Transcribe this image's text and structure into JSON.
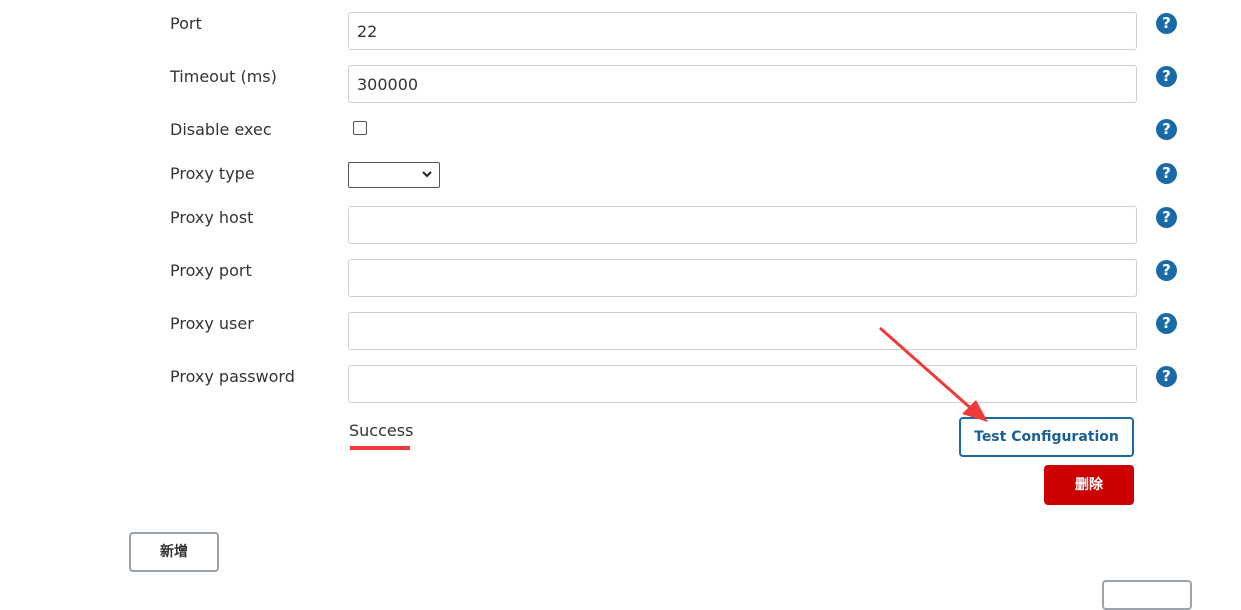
{
  "form": {
    "fields": [
      {
        "label": "Port",
        "value": "22",
        "help": "?"
      },
      {
        "label": "Timeout (ms)",
        "value": "300000",
        "help": "?"
      },
      {
        "label": "Disable exec",
        "checked": false,
        "help": "?"
      },
      {
        "label": "Proxy type",
        "selected": "",
        "help": "?"
      },
      {
        "label": "Proxy host",
        "value": "",
        "help": "?"
      },
      {
        "label": "Proxy port",
        "value": "",
        "help": "?"
      },
      {
        "label": "Proxy user",
        "value": "",
        "help": "?"
      },
      {
        "label": "Proxy password",
        "value": "",
        "help": "?"
      }
    ],
    "status_text": "Success",
    "test_button": "Test Configuration",
    "delete_button": "删除",
    "add_button": "新增",
    "chevron": "⌄"
  },
  "colors": {
    "accent": "#1a6aa8",
    "danger": "#cc0000",
    "annotation": "#f03a3a"
  }
}
